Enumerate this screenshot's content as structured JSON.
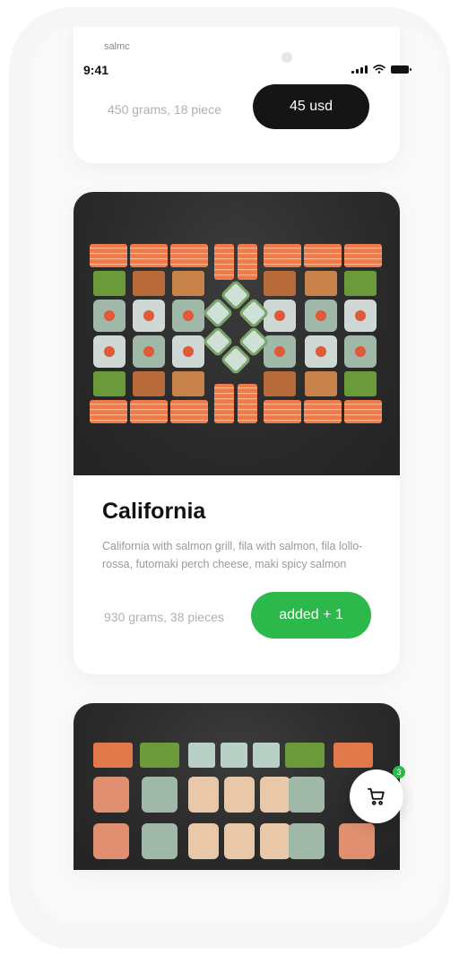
{
  "status_bar": {
    "time": "9:41",
    "cut_off_label": "salmc"
  },
  "cards": {
    "top": {
      "weight": "450 grams, 18 piece",
      "price_label": "45 usd"
    },
    "main": {
      "title": "California",
      "description": "California with salmon grill, fila with salmon, fila lollo-rossa, futomaki perch cheese, maki spicy salmon",
      "weight": "930 grams, 38 pieces",
      "action_label": "added + 1"
    }
  },
  "cart": {
    "badge_count": "3",
    "icon": "cart-icon"
  },
  "colors": {
    "accent_green": "#2db84b",
    "dark_button": "#151515"
  }
}
